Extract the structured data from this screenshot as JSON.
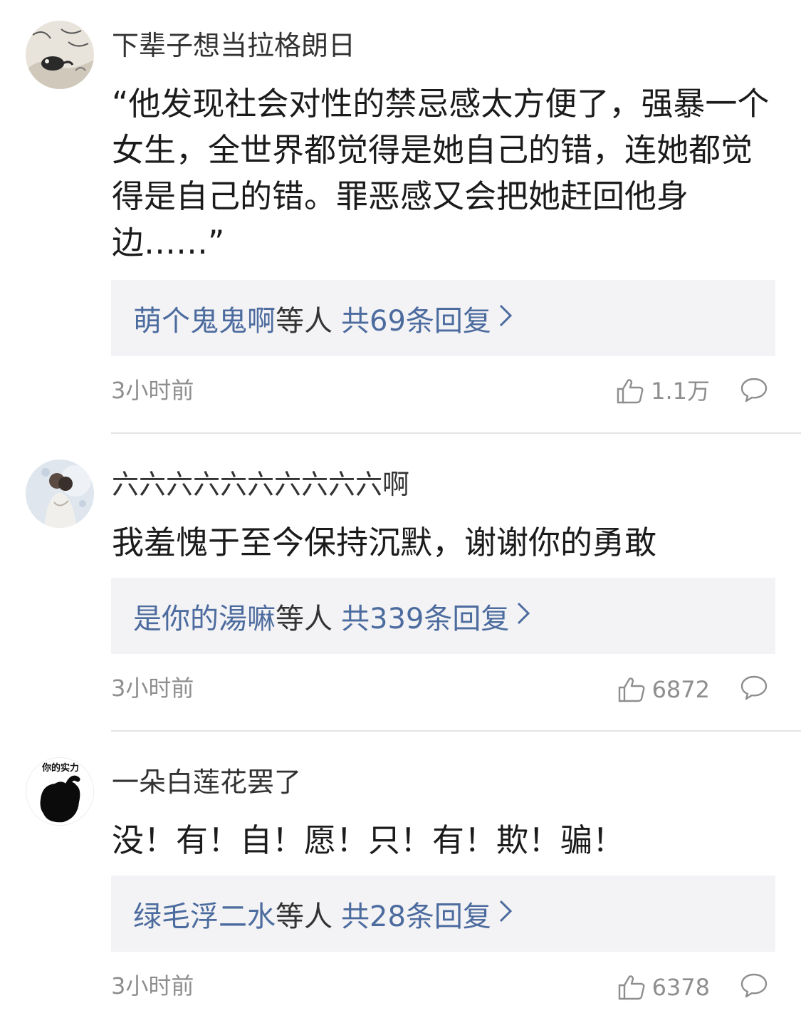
{
  "comments": [
    {
      "username": "下辈子想当拉格朗日",
      "content": "“他发现社会对性的禁忌感太方便了，强暴一个女生，全世界都觉得是她自己的错，连她都觉得是自己的错。罪恶感又会把她赶回他身边……”",
      "reply_users": "萌个鬼鬼啊",
      "reply_mid": "等人",
      "reply_total": "共69条回复",
      "time": "3小时前",
      "likes": "1.1万",
      "avatar_icon": "ink-painting-avatar"
    },
    {
      "username": "六六六六六六六六六六啊",
      "content": "我羞愧于至今保持沉默，谢谢你的勇敢",
      "reply_users": "是你的湯嘛",
      "reply_mid": "等人",
      "reply_total": "共339条回复",
      "time": "3小时前",
      "likes": "6872",
      "avatar_icon": "couple-photo-avatar"
    },
    {
      "username": "一朵白莲花罢了",
      "content": "没！有！自！愿！只！有！欺！骗！",
      "reply_users": "绿毛浮二水",
      "reply_mid": "等人",
      "reply_total": "共28条回复",
      "time": "3小时前",
      "likes": "6378",
      "avatar_icon": "black-hand-avatar",
      "avatar_text": "你的实力"
    }
  ],
  "icons": {
    "like": "thumbs-up-icon",
    "comment": "speech-bubble-icon",
    "chevron": "chevron-right-icon"
  },
  "colors": {
    "link_blue": "#4c6b9e",
    "reply_bg": "#f3f3f5",
    "meta_gray": "#8e8e8e"
  }
}
